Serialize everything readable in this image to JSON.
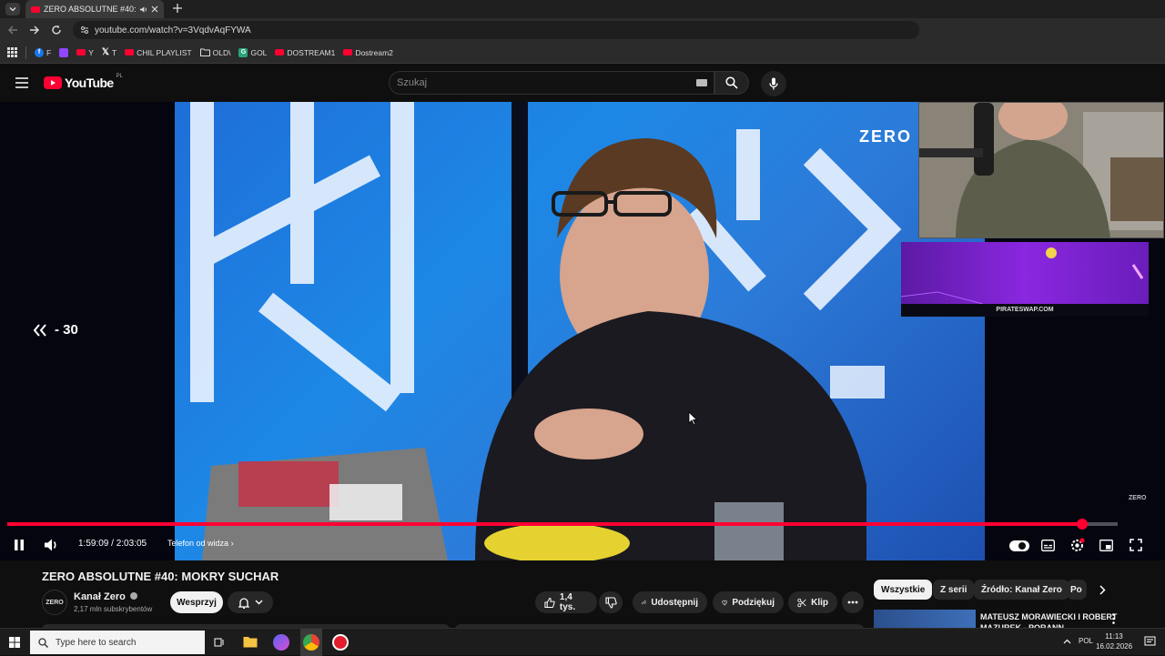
{
  "browser": {
    "tab_title": "ZERO ABSOLUTNE #40: MO",
    "url": "youtube.com/watch?v=3VqdvAqFYWA",
    "bookmarks": [
      {
        "label": "F",
        "icon": "facebook-icon"
      },
      {
        "label": "",
        "icon": "twitch-icon"
      },
      {
        "label": "Y",
        "icon": "youtube-icon"
      },
      {
        "label": "T",
        "icon": "x-icon"
      },
      {
        "label": "CHIL PLAYLIST",
        "icon": "youtube-icon"
      },
      {
        "label": "OLD\\",
        "icon": "folder-icon"
      },
      {
        "label": "GOL",
        "icon": "bookmark-icon"
      },
      {
        "label": "DOSTREAM1",
        "icon": "youtube-icon"
      },
      {
        "label": "Dostream2",
        "icon": "youtube-icon"
      }
    ]
  },
  "youtube": {
    "logo_text": "YouTube",
    "country": "PL",
    "search_placeholder": "Szukaj"
  },
  "player": {
    "seek_back_label": "- 30",
    "current_time": "1:59:09",
    "separator": " / ",
    "duration": "2:03:05",
    "chapter": "Telefon od widza",
    "progress": 0.968,
    "overlay_brand": "ZERO",
    "banner_text": "PIRATESWAP.COM"
  },
  "video": {
    "title": "ZERO ABSOLUTNE #40: MOKRY SUCHAR",
    "channel_name": "Kanał Zero",
    "channel_avatar_text": "ZERO",
    "subscribers": "2,17 mln subskrybentów",
    "support_label": "Wesprzyj",
    "likes": "1,4 tys.",
    "share_label": "Udostępnij",
    "thanks_label": "Podziękuj",
    "clip_label": "Klip"
  },
  "sidebar": {
    "chips": [
      "Wszystkie",
      "Z serii",
      "Źródło: Kanał Zero",
      "Po"
    ],
    "active_chip": "Wszystkie",
    "rec_title": "MATEUSZ MORAWIECKI I ROBERT MAZUREK - PORANN"
  },
  "taskbar": {
    "search_placeholder": "Type here to search",
    "language": "POL",
    "time": "11:13",
    "date": "16.02.2026"
  }
}
